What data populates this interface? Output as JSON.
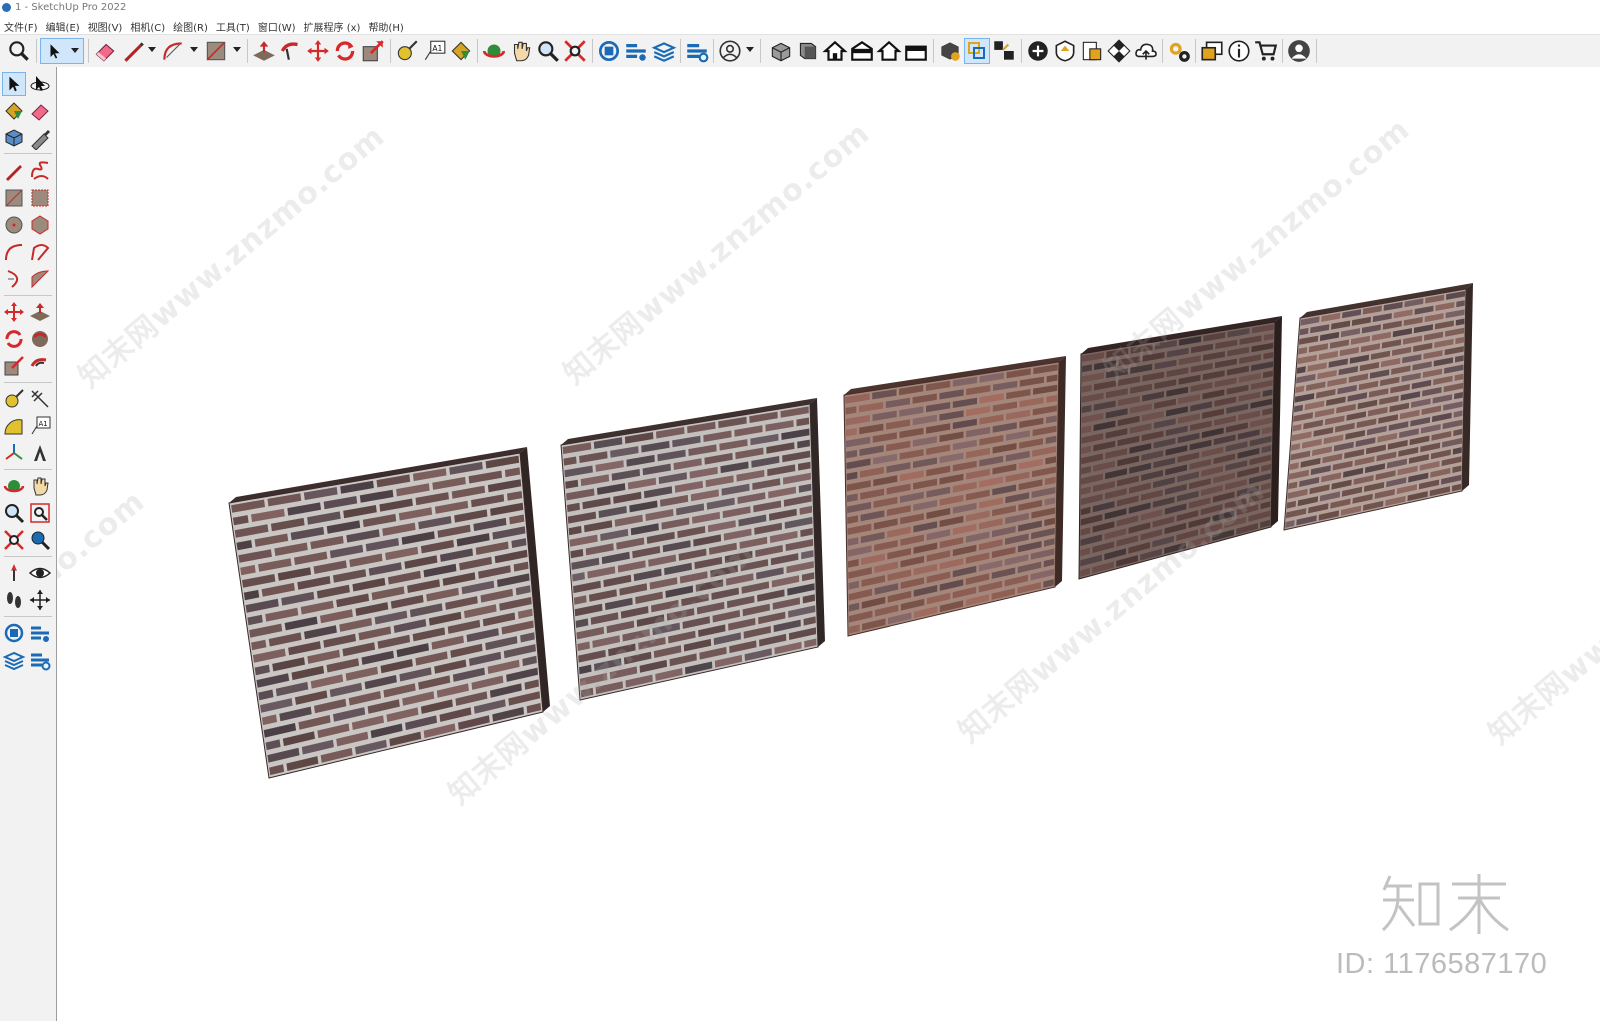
{
  "window": {
    "title": "1 - SketchUp Pro 2022"
  },
  "menu": [
    "文件(F)",
    "编辑(E)",
    "视图(V)",
    "相机(C)",
    "绘图(R)",
    "工具(T)",
    "窗口(W)",
    "扩展程序 (x)",
    "帮助(H)"
  ],
  "toolbar_icons": [
    "zoom-icon",
    "select-icon",
    "eraser-icon",
    "line-icon",
    "arc-icon",
    "rectangle-icon",
    "push-pull-icon",
    "follow-me-icon",
    "move-icon",
    "rotate-icon",
    "scale-icon",
    "tape-measure-icon",
    "text-icon",
    "paint-bucket-icon",
    "orbit-icon",
    "pan-icon",
    "zoom-icon",
    "zoom-extents-icon",
    "warehouse-icon",
    "extension-warehouse-icon",
    "layout-icon",
    "extension-manager-icon",
    "account-icon",
    "iso-view-icon",
    "front-view-icon",
    "top-view-icon",
    "right-view-icon",
    "back-view-icon",
    "left-view-icon",
    "solid-tools-icon",
    "outer-shell-icon",
    "sandbox-icon",
    "add-location-icon",
    "photo-texture-icon",
    "layers-icon",
    "styles-icon",
    "cloud-upload-icon",
    "settings-icon",
    "entity-info-icon",
    "info-icon",
    "cart-icon",
    "profile-icon"
  ],
  "left_toolbar_icons": [
    "select-icon",
    "orbit-icon",
    "paint-bucket-icon",
    "eraser-icon",
    "component-icon",
    "tape-icon",
    "pencil-icon",
    "freehand-icon",
    "rectangle-icon",
    "rotated-rectangle-icon",
    "circle-icon",
    "polygon-icon",
    "arc-icon",
    "two-point-arc-icon",
    "three-point-arc-icon",
    "pie-icon",
    "move-icon",
    "push-pull-icon",
    "rotate-icon",
    "follow-me-icon",
    "scale-icon",
    "offset-icon",
    "tape-measure-icon",
    "dimension-icon",
    "protractor-icon",
    "text-icon",
    "axes-icon",
    "3d-text-icon",
    "orbit-icon",
    "pan-icon",
    "zoom-icon",
    "zoom-window-icon",
    "zoom-extents-icon",
    "previous-view-icon",
    "position-camera-icon",
    "look-around-icon",
    "walk-icon",
    "section-plane-icon",
    "warehouse-icon",
    "extension-warehouse-icon",
    "layout-icon",
    "extension-manager-icon"
  ],
  "scene": {
    "panels": [
      {
        "name": "brick-wall-1",
        "face_color": "#6e5452",
        "mortar_color": "#c9c6c4",
        "brick_alt": "#5a4c52"
      },
      {
        "name": "brick-wall-2",
        "face_color": "#705756",
        "mortar_color": "#c4c0bd",
        "brick_alt": "#5b5056"
      },
      {
        "name": "brick-wall-3",
        "face_color": "#8a5d52",
        "mortar_color": "#a5867b",
        "brick_alt": "#745a5b"
      },
      {
        "name": "brick-wall-4",
        "face_color": "#5e4441",
        "mortar_color": "#7a6660",
        "brick_alt": "#4a3c3e"
      },
      {
        "name": "brick-wall-5",
        "face_color": "#7b5b55",
        "mortar_color": "#b3a19a",
        "brick_alt": "#665256"
      }
    ]
  },
  "watermark": {
    "text": "知末网www.znzmo.com"
  },
  "brand": {
    "logo_text": "知末",
    "id_text": "ID: 1176587170"
  }
}
